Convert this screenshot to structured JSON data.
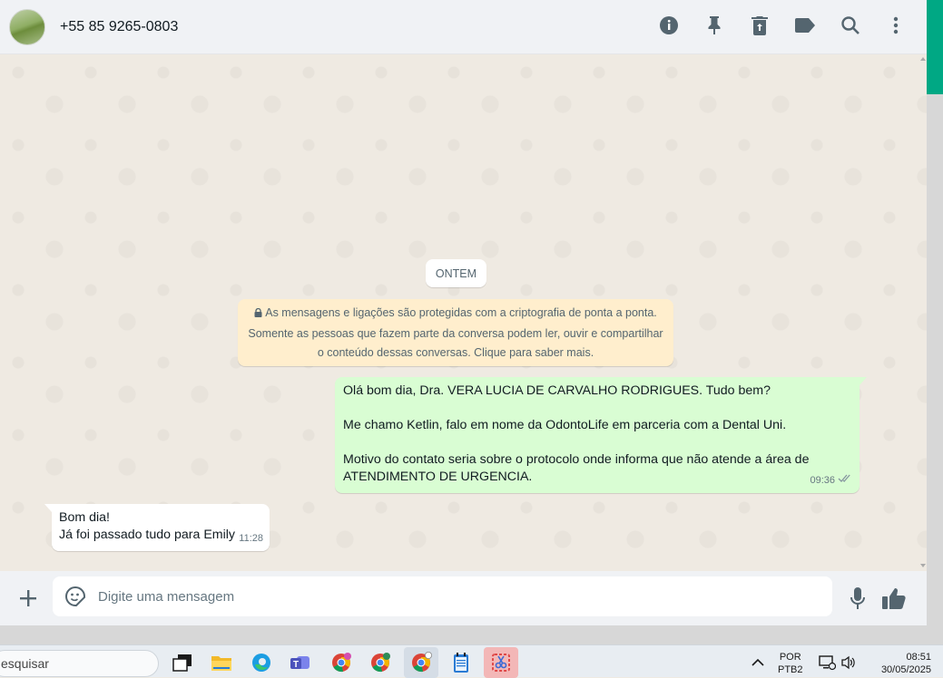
{
  "header": {
    "contact_name": "+55 85 9265-0803",
    "icons": [
      "info-icon",
      "pin-icon",
      "archive-icon",
      "label-icon",
      "search-icon",
      "menu-dots-icon"
    ]
  },
  "chat": {
    "day_label": "ONTEM",
    "encryption_notice": {
      "line1": "As mensagens e ligações são protegidas com a criptografia de ponta a ponta.",
      "line2": "Somente as pessoas que fazem parte da conversa podem ler, ouvir e compartilhar",
      "line3": "o conteúdo dessas conversas. Clique para saber mais."
    },
    "messages": [
      {
        "direction": "out",
        "paragraphs": [
          "Olá bom dia, Dra. VERA LUCIA DE CARVALHO RODRIGUES. Tudo bem?",
          "Me chamo Ketlin, falo em nome da OdontoLife em parceria com a Dental Uni.",
          "Motivo do contato seria sobre o protocolo onde informa que não atende a área de ATENDIMENTO DE URGENCIA."
        ],
        "time": "09:36",
        "status": "double-check"
      },
      {
        "direction": "in",
        "lines": [
          "Bom dia!",
          "Já foi passado tudo para Emily"
        ],
        "time": "11:28"
      }
    ]
  },
  "composer": {
    "placeholder": "Digite uma mensagem"
  },
  "taskbar": {
    "search_text": "esquisar",
    "lang_line1": "POR",
    "lang_line2": "PTB2",
    "clock_time": "08:51",
    "clock_date": "30/05/2025"
  },
  "colors": {
    "outgoing_bubble": "#d9fdd3",
    "incoming_bubble": "#ffffff",
    "notice_bg": "#ffeecd",
    "accent": "#00a884"
  }
}
